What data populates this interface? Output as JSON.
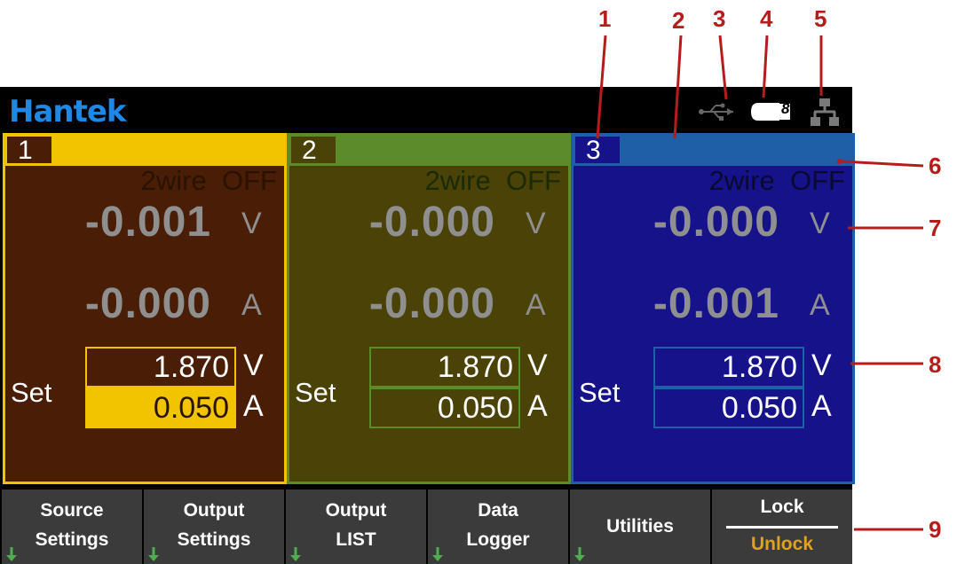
{
  "brand": "Hantek",
  "status": {
    "icons": [
      "usb-icon",
      "usb-drive-icon",
      "network-icon"
    ],
    "drive_label": "8"
  },
  "channels": [
    {
      "number": "1",
      "mode": "2wire",
      "output_state": "OFF",
      "voltage": "-0.001",
      "voltage_unit": "V",
      "current": "-0.000",
      "current_unit": "A",
      "set_label": "Set",
      "set_voltage": "1.870",
      "set_voltage_unit": "V",
      "set_current": "0.050",
      "set_current_unit": "A",
      "colors": {
        "accent": "#f2c400",
        "body": "#4a1d06"
      }
    },
    {
      "number": "2",
      "mode": "2wire",
      "output_state": "OFF",
      "voltage": "-0.000",
      "voltage_unit": "V",
      "current": "-0.000",
      "current_unit": "A",
      "set_label": "Set",
      "set_voltage": "1.870",
      "set_voltage_unit": "V",
      "set_current": "0.050",
      "set_current_unit": "A",
      "colors": {
        "accent": "#5c8c2a",
        "body": "#4a4206"
      }
    },
    {
      "number": "3",
      "mode": "2wire",
      "output_state": "OFF",
      "voltage": "-0.000",
      "voltage_unit": "V",
      "current": "-0.001",
      "current_unit": "A",
      "set_label": "Set",
      "set_voltage": "1.870",
      "set_voltage_unit": "V",
      "set_current": "0.050",
      "set_current_unit": "A",
      "colors": {
        "accent": "#1f5fa8",
        "body": "#16138a"
      }
    }
  ],
  "softkeys": [
    {
      "line1": "Source",
      "line2": "Settings",
      "has_arrow": true
    },
    {
      "line1": "Output",
      "line2": "Settings",
      "has_arrow": true
    },
    {
      "line1": "Output",
      "line2": "LIST",
      "has_arrow": true
    },
    {
      "line1": "Data",
      "line2": "Logger",
      "has_arrow": true
    },
    {
      "line1": "Utilities",
      "line2": "",
      "has_arrow": true
    },
    {
      "line1": "Lock",
      "line2": "Unlock",
      "has_arrow": false
    }
  ],
  "callouts": [
    "1",
    "2",
    "3",
    "4",
    "5",
    "6",
    "7",
    "8",
    "9"
  ],
  "colors": {
    "callout": "#b71c1c",
    "brand": "#1e88e5",
    "unlock": "#e0a020"
  }
}
